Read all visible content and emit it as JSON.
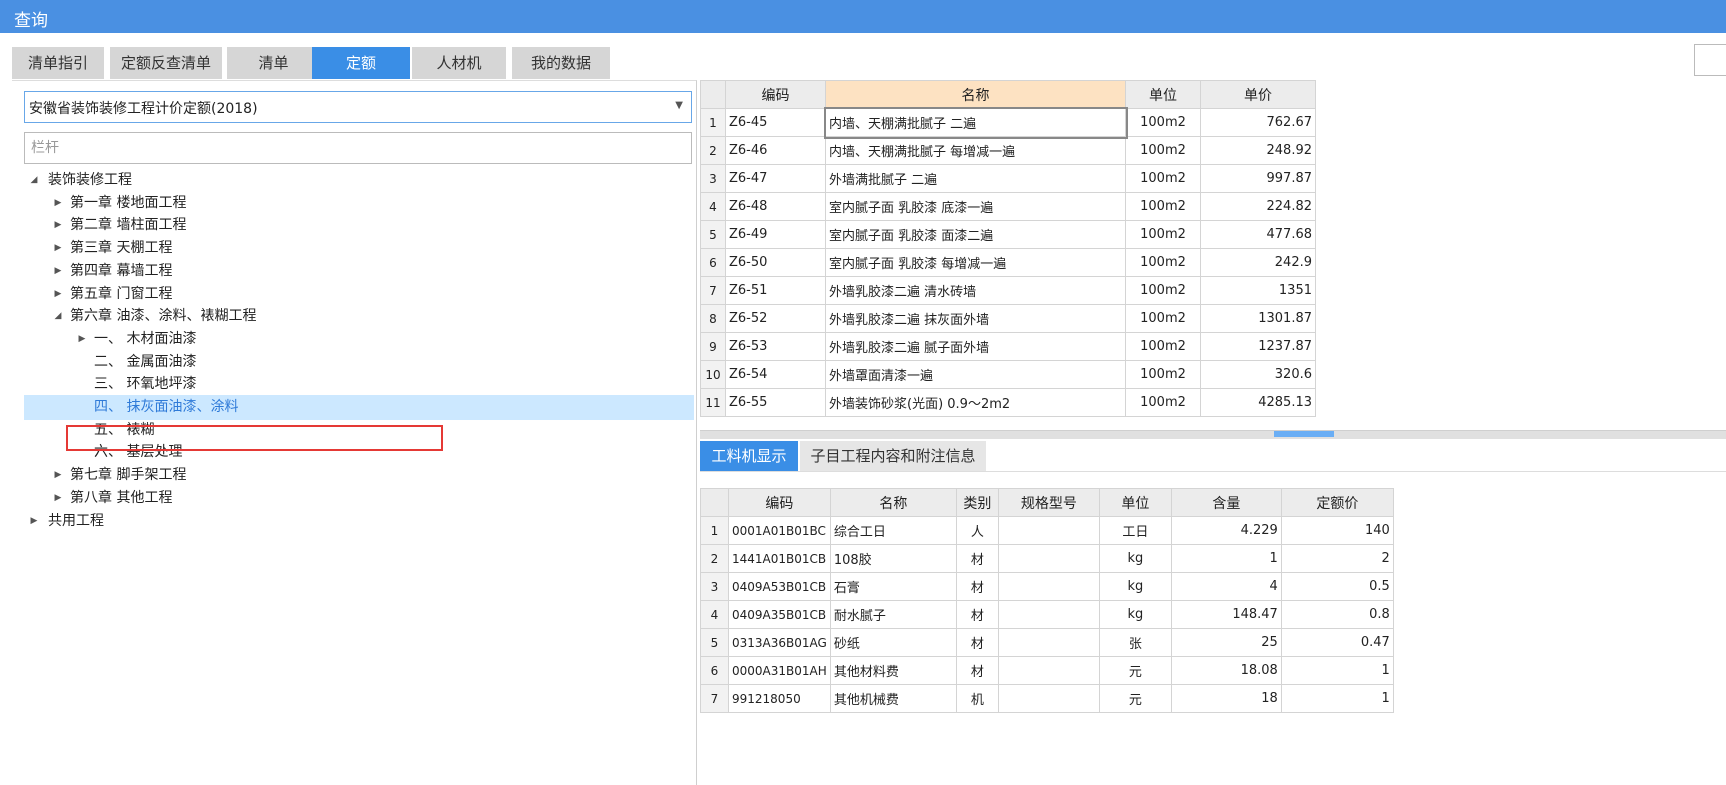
{
  "window": {
    "title": "查询"
  },
  "tabs": [
    {
      "label": "清单指引",
      "active": false
    },
    {
      "label": "定额反查清单",
      "active": false
    },
    {
      "label": "清单",
      "active": false
    },
    {
      "label": "定额",
      "active": true
    },
    {
      "label": "人材机",
      "active": false
    },
    {
      "label": "我的数据",
      "active": false
    }
  ],
  "left": {
    "library": "安徽省装饰装修工程计价定额(2018)",
    "search": {
      "placeholder": "栏杆"
    },
    "tree": [
      {
        "label": "装饰装修工程",
        "level": 0,
        "expanded": true,
        "has_children": true
      },
      {
        "label": "第一章 楼地面工程",
        "level": 1,
        "has_children": true
      },
      {
        "label": "第二章 墙柱面工程",
        "level": 1,
        "has_children": true
      },
      {
        "label": "第三章 天棚工程",
        "level": 1,
        "has_children": true
      },
      {
        "label": "第四章 幕墙工程",
        "level": 1,
        "has_children": true
      },
      {
        "label": "第五章 门窗工程",
        "level": 1,
        "has_children": true
      },
      {
        "label": "第六章 油漆、涂料、裱糊工程",
        "level": 1,
        "expanded": true,
        "has_children": true
      },
      {
        "label": "一、 木材面油漆",
        "level": 2,
        "has_children": true
      },
      {
        "label": "二、 金属面油漆",
        "level": 2,
        "has_children": false
      },
      {
        "label": "三、 环氧地坪漆",
        "level": 2,
        "has_children": false
      },
      {
        "label": "四、 抹灰面油漆、涂料",
        "level": 2,
        "has_children": false,
        "selected": true
      },
      {
        "label": "五、 裱糊",
        "level": 2,
        "has_children": false
      },
      {
        "label": "六、 基层处理",
        "level": 2,
        "has_children": false
      },
      {
        "label": "第七章 脚手架工程",
        "level": 1,
        "has_children": true
      },
      {
        "label": "第八章 其他工程",
        "level": 1,
        "has_children": true
      },
      {
        "label": "共用工程",
        "level": 0,
        "has_children": true
      }
    ]
  },
  "quota_table": {
    "headers": [
      "编码",
      "名称",
      "单位",
      "单价"
    ],
    "rows": [
      [
        "Z6-45",
        "内墙、天棚满批腻子 二遍",
        "100m2",
        "762.67"
      ],
      [
        "Z6-46",
        "内墙、天棚满批腻子 每增减一遍",
        "100m2",
        "248.92"
      ],
      [
        "Z6-47",
        "外墙满批腻子 二遍",
        "100m2",
        "997.87"
      ],
      [
        "Z6-48",
        "室内腻子面 乳胶漆 底漆一遍",
        "100m2",
        "224.82"
      ],
      [
        "Z6-49",
        "室内腻子面 乳胶漆 面漆二遍",
        "100m2",
        "477.68"
      ],
      [
        "Z6-50",
        "室内腻子面 乳胶漆 每增减一遍",
        "100m2",
        "242.9"
      ],
      [
        "Z6-51",
        "外墙乳胶漆二遍 清水砖墙",
        "100m2",
        "1351"
      ],
      [
        "Z6-52",
        "外墙乳胶漆二遍 抹灰面外墙",
        "100m2",
        "1301.87"
      ],
      [
        "Z6-53",
        "外墙乳胶漆二遍 腻子面外墙",
        "100m2",
        "1237.87"
      ],
      [
        "Z6-54",
        "外墙罩面清漆一遍",
        "100m2",
        "320.6"
      ],
      [
        "Z6-55",
        "外墙装饰砂浆(光面) 0.9～2m2",
        "100m2",
        "4285.13"
      ]
    ]
  },
  "lower_tabs": [
    {
      "label": "工料机显示",
      "active": true
    },
    {
      "label": "子目工程内容和附注信息",
      "active": false
    }
  ],
  "resource_table": {
    "headers": [
      "编码",
      "名称",
      "类别",
      "规格型号",
      "单位",
      "含量",
      "定额价"
    ],
    "rows": [
      [
        "0001A01B01BC",
        "综合工日",
        "人",
        "",
        "工日",
        "4.229",
        "140"
      ],
      [
        "1441A01B01CB",
        "108胶",
        "材",
        "",
        "kg",
        "1",
        "2"
      ],
      [
        "0409A53B01CB",
        "石膏",
        "材",
        "",
        "kg",
        "4",
        "0.5"
      ],
      [
        "0409A35B01CB",
        "耐水腻子",
        "材",
        "",
        "kg",
        "148.47",
        "0.8"
      ],
      [
        "0313A36B01AG",
        "砂纸",
        "材",
        "",
        "张",
        "25",
        "0.47"
      ],
      [
        "0000A31B01AH",
        "其他材料费",
        "材",
        "",
        "元",
        "18.08",
        "1"
      ],
      [
        "991218050",
        "其他机械费",
        "机",
        "",
        "元",
        "18",
        "1"
      ]
    ]
  },
  "colors": {
    "title_bar": "#4a90e2",
    "active_tab": "#3a8ee6",
    "selection": "#cce8ff",
    "highlight_box": "#e53935"
  }
}
